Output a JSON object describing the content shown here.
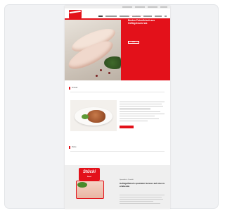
{
  "hero": {
    "kicker": "Spezialität • Produkt",
    "title": "Besten Putenfleisch aus Geflügelwurst wa",
    "button": "Mehr"
  },
  "section1": {
    "title": "Produkt"
  },
  "section2": {
    "title": "Marke"
  },
  "brand": {
    "name": "Stücki",
    "tag": "Brand"
  },
  "lower": {
    "kicker": "Spezialität • Produkt",
    "title": "Geflügelfleisch-spezialen Genuss auf eine zu erlebende"
  },
  "colors": {
    "accent": "#e3111a",
    "card_bg": "#f1f2f4"
  }
}
